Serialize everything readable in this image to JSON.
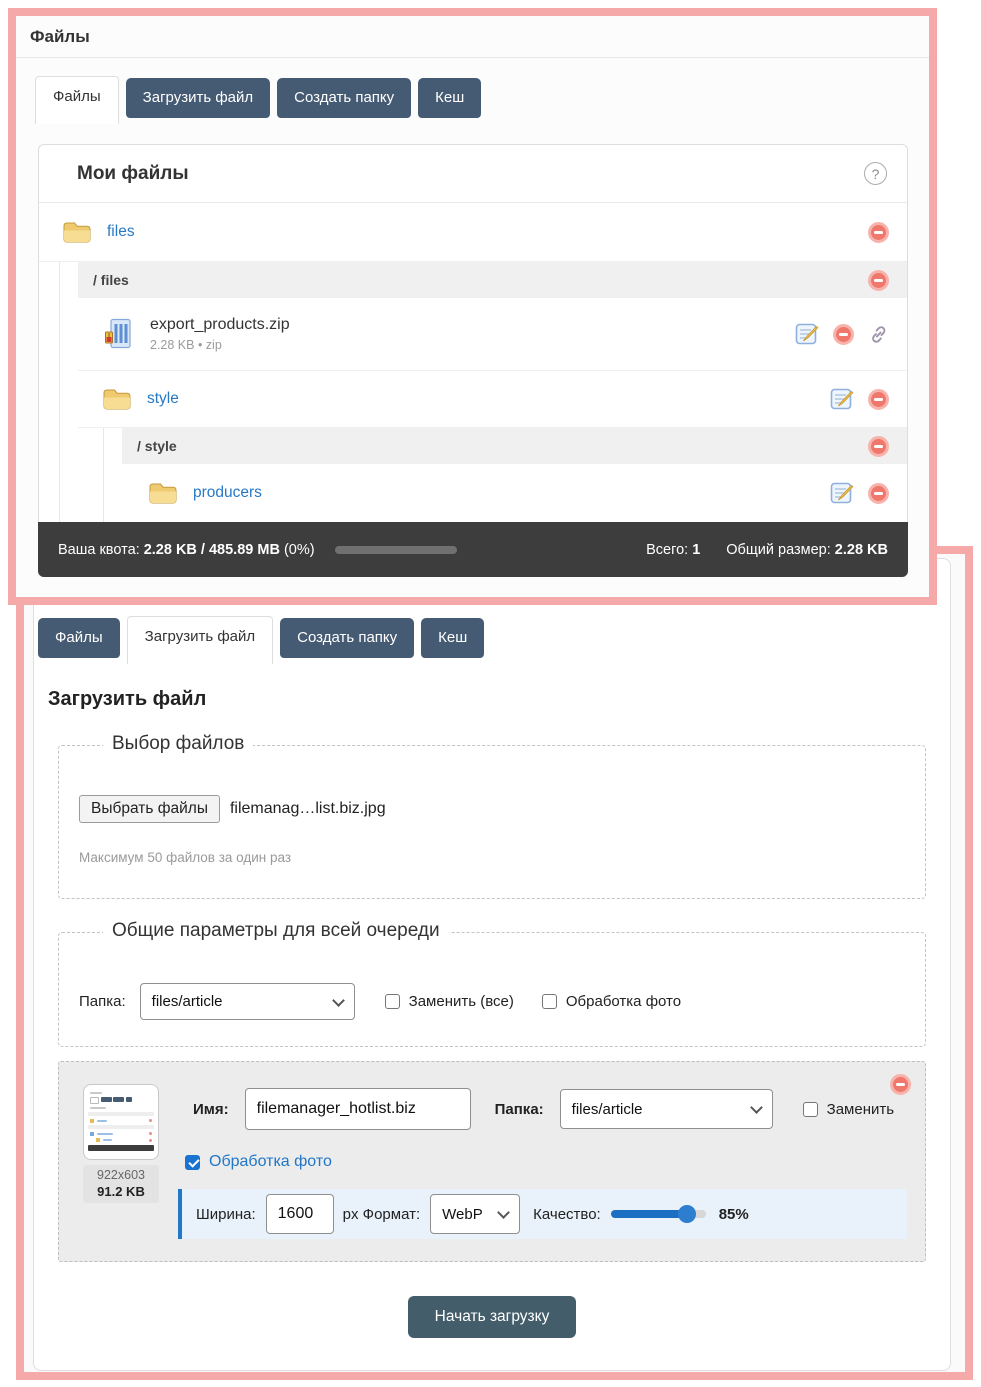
{
  "colors": {
    "annotation_pink": "#f6a9a9",
    "tab_dark": "#455a73",
    "link_blue": "#2779c6",
    "delete_red": "#ef776b",
    "quota_bar": "#3d3d3d",
    "slider_blue": "#1b6ec2",
    "photo_row_accent": "#2178ca"
  },
  "top_panel": {
    "title": "Файлы",
    "tabs": [
      {
        "label": "Файлы"
      },
      {
        "label": "Загрузить файл"
      },
      {
        "label": "Создать папку"
      },
      {
        "label": "Кеш"
      }
    ],
    "files": {
      "title": "Мои файлы",
      "help": "?",
      "rows": {
        "files_label": "files",
        "files_path": "/ files",
        "zip_name": "export_products.zip",
        "zip_meta": "2.28 KB • zip",
        "style_label": "style",
        "style_path": "/ style",
        "producers_label": "producers"
      },
      "quota": {
        "label": "Ваша квота:",
        "value": "2.28 KB / 485.89 MB",
        "percent": "(0%)",
        "total_label": "Всего:",
        "total_value": "1",
        "size_label": "Общий размер:",
        "size_value": "2.28 KB"
      }
    }
  },
  "upload_panel": {
    "tabs": [
      {
        "label": "Файлы"
      },
      {
        "label": "Загрузить файл"
      },
      {
        "label": "Создать папку"
      },
      {
        "label": "Кеш"
      }
    ],
    "heading": "Загрузить файл",
    "file_select": {
      "legend": "Выбор файлов",
      "button": "Выбрать файлы",
      "filename": "filemanag…list.biz.jpg",
      "hint": "Максимум 50 файлов за один раз"
    },
    "common": {
      "legend": "Общие параметры для всей очереди",
      "folder_label": "Папка:",
      "folder_value": "files/article",
      "replace_all_label": "Заменить (все)",
      "photo_label": "Обработка фото"
    },
    "item": {
      "dimensions": "922x603",
      "size": "91.2 KB",
      "name_label": "Имя:",
      "name_value": "filemanager_hotlist.biz",
      "folder_label": "Папка:",
      "folder_value": "files/article",
      "replace_label": "Заменить",
      "photo_label": "Обработка фото",
      "width_label": "Ширина:",
      "width_value": "1600",
      "format_label": "px Формат:",
      "format_value": "WebP",
      "quality_label": "Качество:",
      "quality_value": "85%",
      "quality_percent": 80
    },
    "submit_label": "Начать загрузку"
  }
}
